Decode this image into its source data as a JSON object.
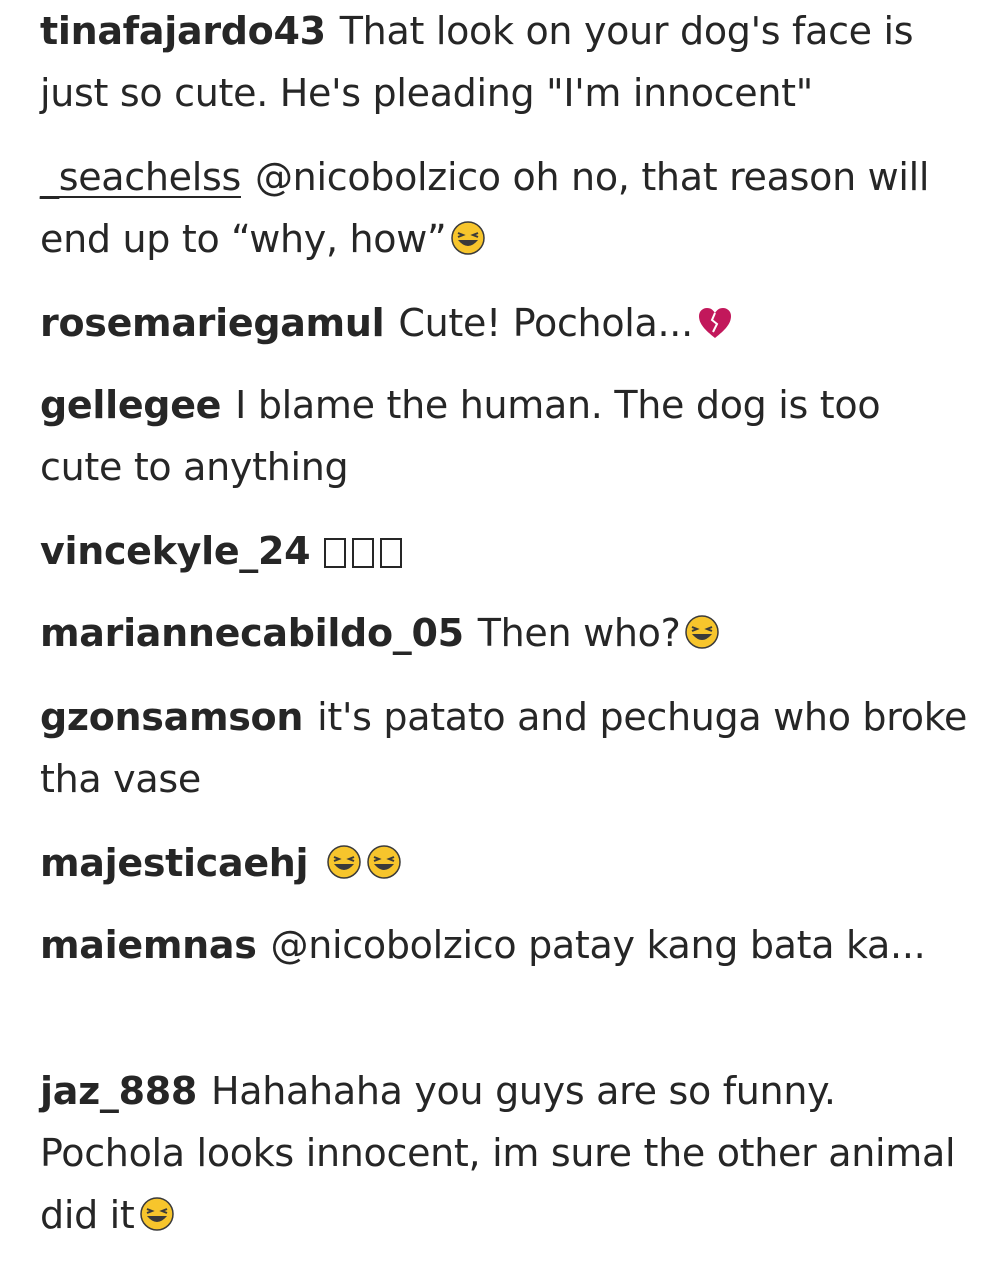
{
  "comments": [
    {
      "username": "tinafajardo43",
      "text": "That look on your dog's face is just so cute. He's pleading \"I'm innocent\""
    },
    {
      "username": "_seachelss",
      "text": "@nicobolzico oh no, that reason will end up to “why, how”",
      "emoji": "grinning-squint-face"
    },
    {
      "username": "rosemariegamul",
      "text": "Cute! Pochola...",
      "emoji": "broken-heart"
    },
    {
      "username": "gellegee",
      "text": "I blame the human. The dog is too cute to anything"
    },
    {
      "username": "vincekyle_24",
      "text": "",
      "emoji": "missing-glyph-boxes"
    },
    {
      "username": "mariannecabildo_05",
      "text": "Then who?",
      "emoji": "grinning-squint-face"
    },
    {
      "username": "gzonsamson",
      "text": "it's patato and pechuga who broke tha vase"
    },
    {
      "username": "majesticaehj",
      "text": "",
      "emoji": "two-grinning-squint-faces"
    },
    {
      "username": "maiemnas",
      "text": "@nicobolzico patay kang bata ka..."
    },
    {
      "username": "jaz_888",
      "text": "Hahahaha you guys are so funny. Pochola looks innocent, im sure the other animal did it",
      "emoji": "grinning-squint-face"
    }
  ],
  "colors": {
    "text": "#262626",
    "background": "#ffffff",
    "emoji_face": "#f7c52c",
    "heart": "#c2185b"
  }
}
